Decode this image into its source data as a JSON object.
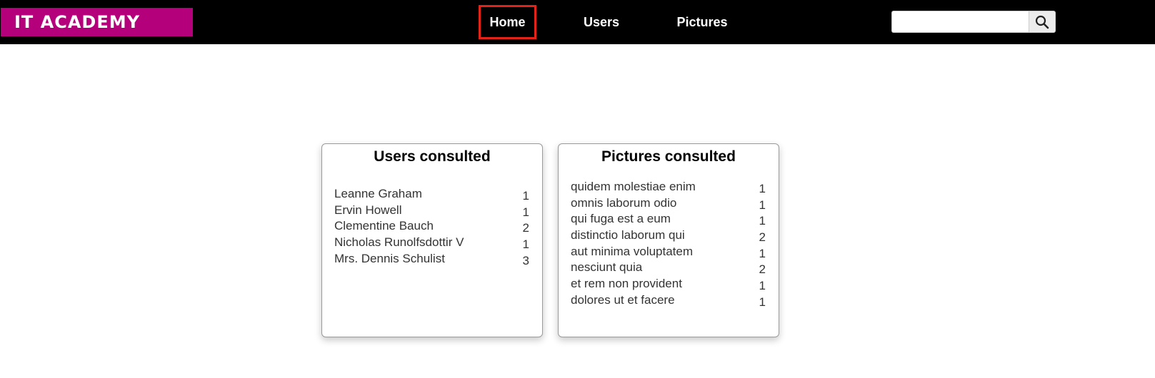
{
  "header": {
    "logo": "IT ACADEMY",
    "nav": {
      "home": "Home",
      "users": "Users",
      "pictures": "Pictures"
    },
    "search": {
      "value": "",
      "placeholder": ""
    }
  },
  "users_card": {
    "title": "Users consulted",
    "items": [
      {
        "name": "Leanne Graham",
        "count": "1"
      },
      {
        "name": "Ervin Howell",
        "count": "1"
      },
      {
        "name": "Clementine Bauch",
        "count": "2"
      },
      {
        "name": "Nicholas Runolfsdottir V",
        "count": "1"
      },
      {
        "name": "Mrs. Dennis Schulist",
        "count": "3"
      }
    ]
  },
  "pictures_card": {
    "title": "Pictures consulted",
    "items": [
      {
        "name": "quidem molestiae enim",
        "count": "1"
      },
      {
        "name": "omnis laborum odio",
        "count": "1"
      },
      {
        "name": "qui fuga est a eum",
        "count": "1"
      },
      {
        "name": "distinctio laborum qui",
        "count": "2"
      },
      {
        "name": "aut minima voluptatem",
        "count": "1"
      },
      {
        "name": "nesciunt quia",
        "count": "2"
      },
      {
        "name": "et rem non provident",
        "count": "1"
      },
      {
        "name": "dolores ut et facere",
        "count": "1"
      }
    ]
  },
  "colors": {
    "navbar": "#000000",
    "logo_background": "#b5007b",
    "active_nav_border": "#e2231a"
  },
  "icons": {
    "search_button": "search-icon"
  }
}
